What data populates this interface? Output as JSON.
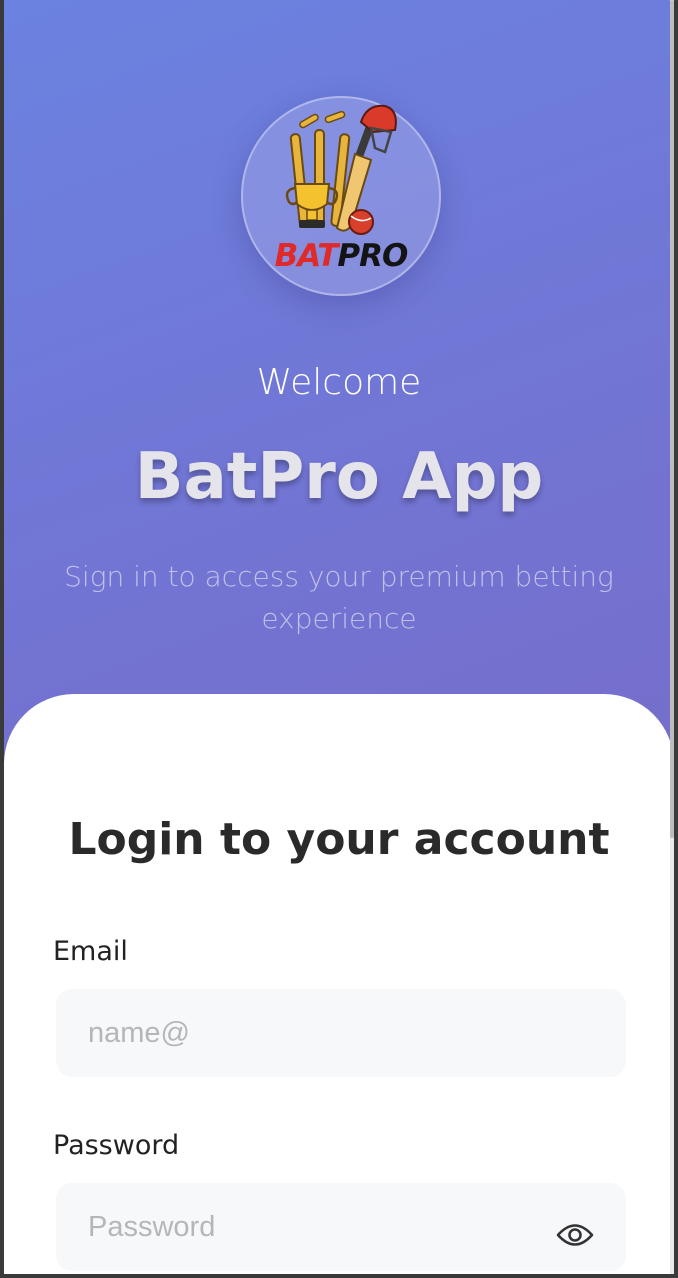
{
  "logo": {
    "brand_part1": "BAT",
    "brand_part2": "PRO"
  },
  "hero": {
    "welcome": "Welcome",
    "title": "BatPro App",
    "subtitle": "Sign in to access your premium betting experience"
  },
  "login": {
    "heading": "Login to your account",
    "email_label": "Email",
    "email_placeholder": "name@",
    "email_value": "",
    "password_label": "Password",
    "password_placeholder": "Password",
    "password_value": ""
  },
  "icons": {
    "logo": "batpro-logo-icon",
    "password_toggle": "eye-icon"
  },
  "colors": {
    "gradient_start": "#6b82e0",
    "gradient_end": "#7a66c0",
    "brand_red": "#e02a2a",
    "input_bg": "#f7f8fa"
  }
}
